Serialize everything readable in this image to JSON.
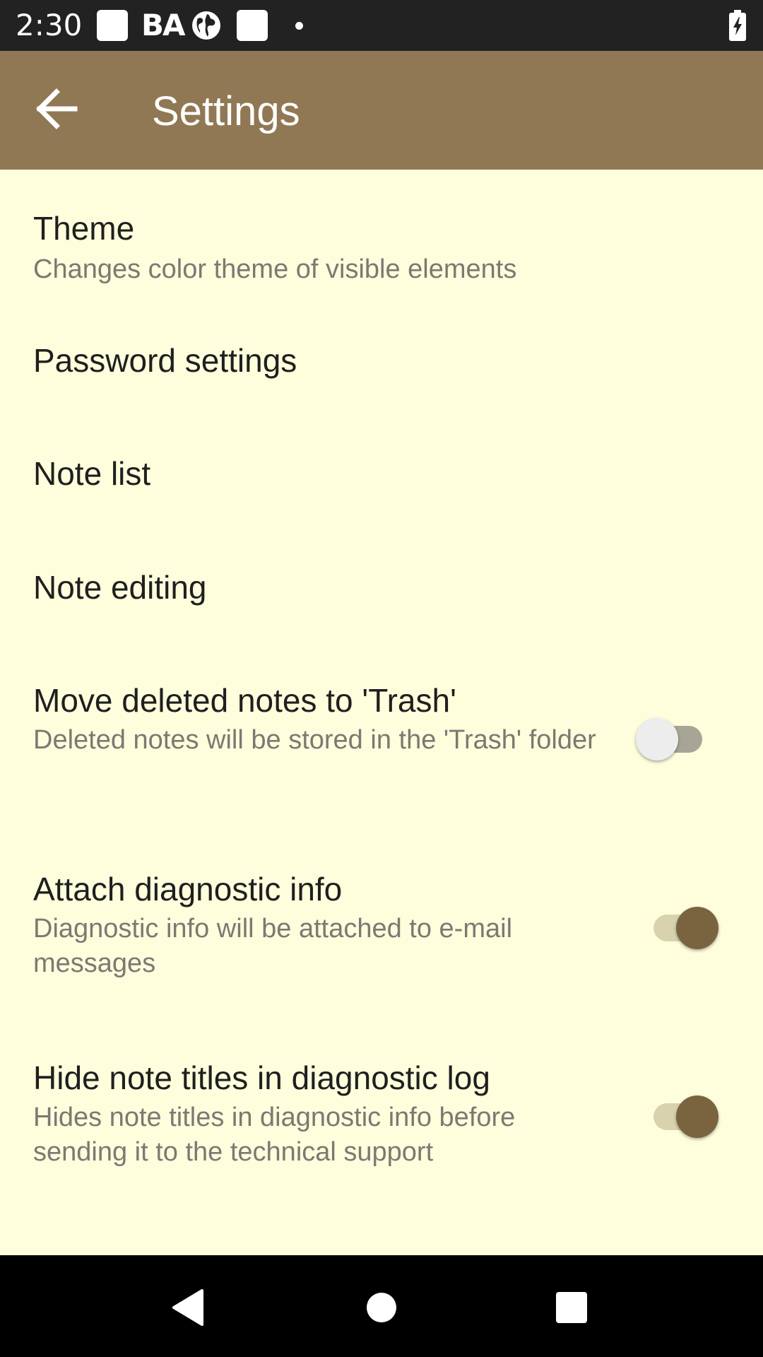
{
  "status_bar": {
    "time": "2:30",
    "badge_text": "BA",
    "icons": [
      "square-notification-icon",
      "ba-icon",
      "globe-icon",
      "square-notification-icon",
      "dot-icon",
      "battery-charging-icon"
    ]
  },
  "app_bar": {
    "title": "Settings",
    "back_icon": "arrow-back-icon",
    "background": "#917854"
  },
  "settings": [
    {
      "title": "Theme",
      "summary": "Changes color theme of visible elements"
    },
    {
      "title": "Password settings"
    },
    {
      "title": "Note list"
    },
    {
      "title": "Note editing"
    },
    {
      "title": "Move deleted notes to 'Trash'",
      "summary": "Deleted notes will be stored in the 'Trash' folder",
      "switch_on": false
    },
    {
      "title": "Attach diagnostic info",
      "summary": "Diagnostic info will be attached to e-mail messages",
      "switch_on": true
    },
    {
      "title": "Hide note titles in diagnostic log",
      "summary": "Hides note titles in diagnostic info before sending it to the technical support",
      "switch_on": true
    }
  ],
  "colors": {
    "background": "#FEFEDD",
    "accent": "#7A6440",
    "title_text": "#1F1F1F",
    "summary_text": "#7A7A72"
  },
  "nav_bar": {
    "icons": [
      "back-triangle-icon",
      "home-circle-icon",
      "recents-square-icon"
    ]
  }
}
